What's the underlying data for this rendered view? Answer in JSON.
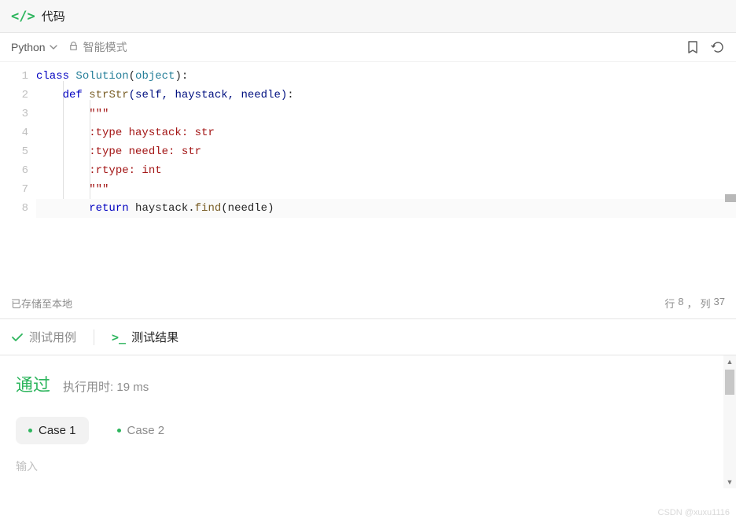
{
  "header": {
    "title": "代码"
  },
  "toolbar": {
    "language": "Python",
    "mode_label": "智能模式"
  },
  "code": {
    "lines": [
      "1",
      "2",
      "3",
      "4",
      "5",
      "6",
      "7",
      "8"
    ],
    "tokens": {
      "class_kw": "class",
      "class_name": "Solution",
      "base": "object",
      "def_kw": "def",
      "fn_name": "strStr",
      "params": "(self, haystack, needle)",
      "doc_open": "\"\"\"",
      "doc_l1": ":type haystack: str",
      "doc_l2": ":type needle: str",
      "doc_l3": ":rtype: int",
      "doc_close": "\"\"\"",
      "return_kw": "return",
      "expr_pre": " haystack.",
      "find": "find",
      "expr_post": "(needle)"
    }
  },
  "status": {
    "saved": "已存储至本地",
    "line_label": "行",
    "line_no": "8",
    "sep": "，",
    "col_label": "列",
    "col_no": "37"
  },
  "tabs": {
    "testcases": "测试用例",
    "testresult": "测试结果"
  },
  "result": {
    "pass": "通过",
    "runtime": "执行用时: 19 ms",
    "case1": "Case 1",
    "case2": "Case 2",
    "input_label": "输入"
  },
  "watermark": "CSDN @xuxu1116"
}
